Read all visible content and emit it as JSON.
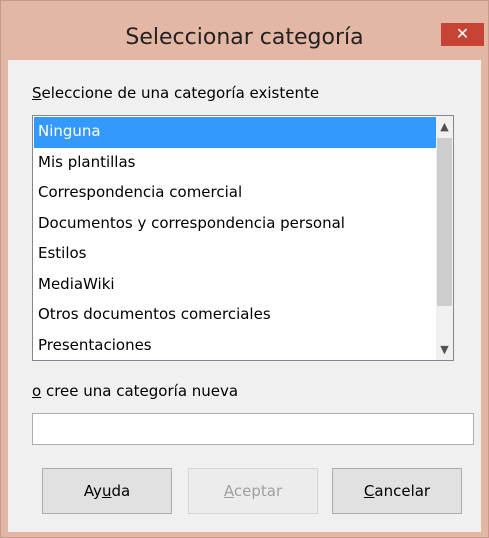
{
  "window": {
    "title": "Seleccionar categoría",
    "close_glyph": "✕"
  },
  "existing": {
    "label": "Seleccione de una categoría existente",
    "label_accel": "S",
    "label_rest": "eleccione de una categoría existente",
    "items": [
      "Ninguna",
      "Mis plantillas",
      "Correspondencia comercial",
      "Documentos y correspondencia personal",
      "Estilos",
      "MediaWiki",
      "Otros documentos comerciales",
      "Presentaciones"
    ],
    "selected": "Ninguna"
  },
  "new_category": {
    "label": "o cree una categoría nueva",
    "label_accel": "o",
    "label_rest": " cree una categoría nueva",
    "value": ""
  },
  "buttons": {
    "help": {
      "label": "Ayuda",
      "pre": "Ay",
      "accel": "u",
      "post": "da"
    },
    "ok": {
      "label": "Aceptar",
      "pre": "",
      "accel": "A",
      "post": "ceptar",
      "enabled": false
    },
    "cancel": {
      "label": "Cancelar",
      "pre": "",
      "accel": "C",
      "post": "ancelar"
    }
  },
  "icons": {
    "close": "close-icon",
    "scroll_up": "chevron-up-icon",
    "scroll_down": "chevron-down-icon"
  },
  "colors": {
    "titlebar": "#e4b6a4",
    "close_button": "#c74335",
    "selection": "#3399ff",
    "dialog_bg": "#f0f0f0"
  }
}
